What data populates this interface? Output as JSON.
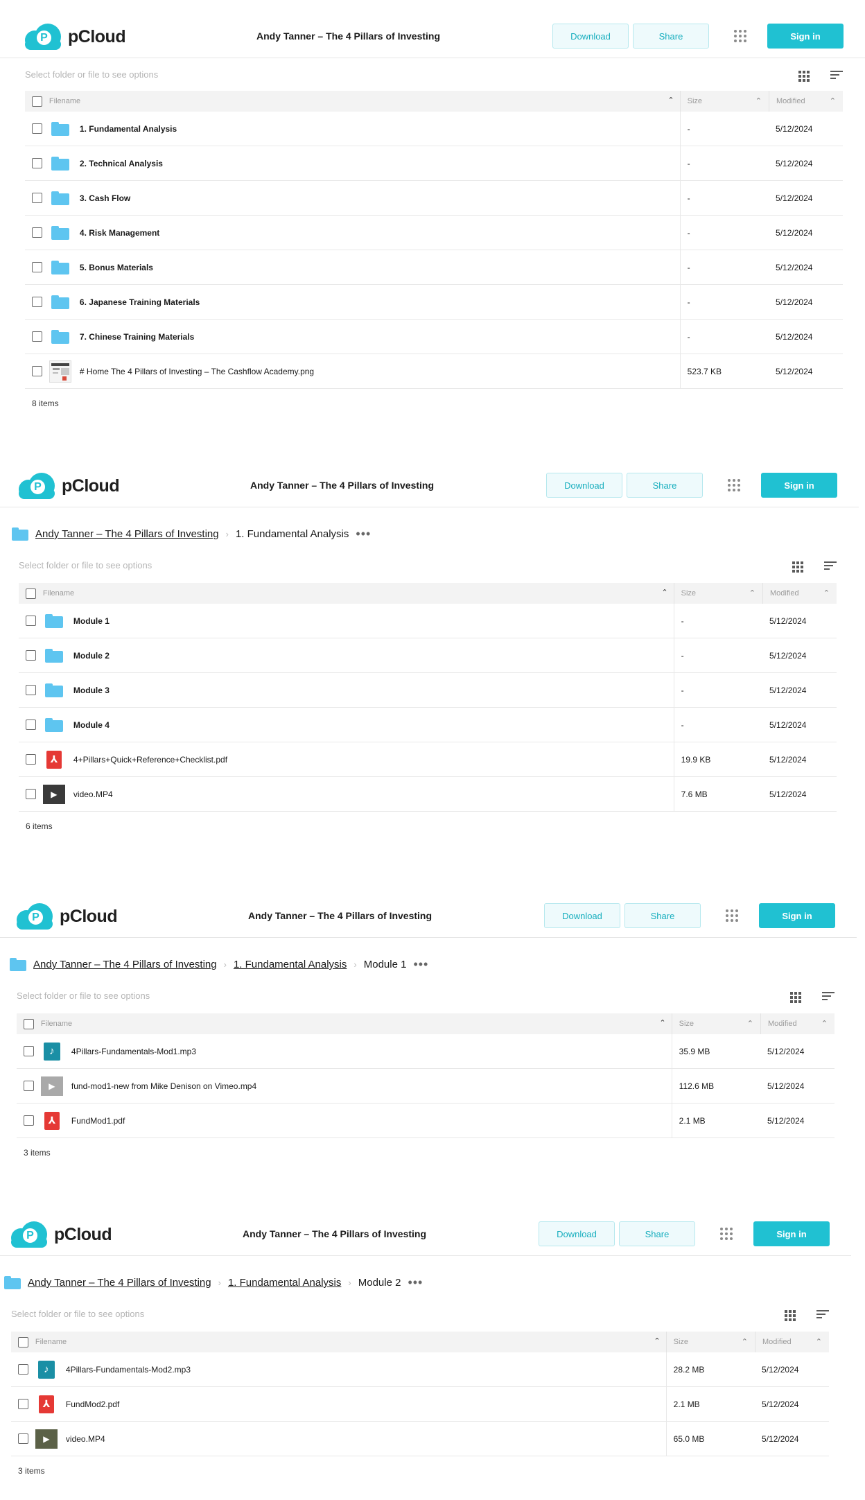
{
  "brand": {
    "name": "pCloud",
    "logo_letter": "P"
  },
  "colors": {
    "accent": "#20c1d2",
    "folder": "#5ec5f0",
    "pdf": "#e53935",
    "audio": "#1a8fa5"
  },
  "header": {
    "title": "Andy Tanner – The 4 Pillars of Investing",
    "download_label": "Download",
    "share_label": "Share",
    "signin_label": "Sign in"
  },
  "toolbar": {
    "hint": "Select folder or file to see options"
  },
  "columns": {
    "name": "Filename",
    "size": "Size",
    "modified": "Modified"
  },
  "panels": [
    {
      "breadcrumb": [],
      "current": "",
      "count": "8 items",
      "rows": [
        {
          "icon": "folder",
          "name": "1. Fundamental Analysis",
          "size": "-",
          "modified": "5/12/2024",
          "bold": true
        },
        {
          "icon": "folder",
          "name": "2. Technical Analysis",
          "size": "-",
          "modified": "5/12/2024",
          "bold": true
        },
        {
          "icon": "folder",
          "name": "3. Cash Flow",
          "size": "-",
          "modified": "5/12/2024",
          "bold": true
        },
        {
          "icon": "folder",
          "name": "4. Risk Management",
          "size": "-",
          "modified": "5/12/2024",
          "bold": true
        },
        {
          "icon": "folder",
          "name": "5. Bonus Materials",
          "size": "-",
          "modified": "5/12/2024",
          "bold": true
        },
        {
          "icon": "folder",
          "name": "6. Japanese Training Materials",
          "size": "-",
          "modified": "5/12/2024",
          "bold": true
        },
        {
          "icon": "folder",
          "name": "7. Chinese Training Materials",
          "size": "-",
          "modified": "5/12/2024",
          "bold": true
        },
        {
          "icon": "image",
          "name": "# Home The 4 Pillars of Investing – The Cashflow Academy.png",
          "size": "523.7 KB",
          "modified": "5/12/2024",
          "bold": false
        }
      ]
    },
    {
      "breadcrumb": [
        "Andy Tanner – The 4 Pillars of Investing"
      ],
      "current": "1. Fundamental Analysis",
      "count": "6 items",
      "rows": [
        {
          "icon": "folder",
          "name": "Module 1",
          "size": "-",
          "modified": "5/12/2024",
          "bold": true
        },
        {
          "icon": "folder",
          "name": "Module 2",
          "size": "-",
          "modified": "5/12/2024",
          "bold": true
        },
        {
          "icon": "folder",
          "name": "Module 3",
          "size": "-",
          "modified": "5/12/2024",
          "bold": true
        },
        {
          "icon": "folder",
          "name": "Module 4",
          "size": "-",
          "modified": "5/12/2024",
          "bold": true
        },
        {
          "icon": "pdf",
          "name": "4+Pillars+Quick+Reference+Checklist.pdf",
          "size": "19.9 KB",
          "modified": "5/12/2024",
          "bold": false
        },
        {
          "icon": "video",
          "name": "video.MP4",
          "size": "7.6 MB",
          "modified": "5/12/2024",
          "bold": false
        }
      ]
    },
    {
      "breadcrumb": [
        "Andy Tanner – The 4 Pillars of Investing",
        "1. Fundamental Analysis"
      ],
      "current": "Module 1",
      "count": "3 items",
      "rows": [
        {
          "icon": "audio",
          "name": "4Pillars-Fundamentals-Mod1.mp3",
          "size": "35.9 MB",
          "modified": "5/12/2024",
          "bold": false
        },
        {
          "icon": "video-gray",
          "name": "fund-mod1-new from Mike Denison on Vimeo.mp4",
          "size": "112.6 MB",
          "modified": "5/12/2024",
          "bold": false
        },
        {
          "icon": "pdf",
          "name": "FundMod1.pdf",
          "size": "2.1 MB",
          "modified": "5/12/2024",
          "bold": false
        }
      ]
    },
    {
      "breadcrumb": [
        "Andy Tanner – The 4 Pillars of Investing",
        "1. Fundamental Analysis"
      ],
      "current": "Module 2",
      "count": "3 items",
      "rows": [
        {
          "icon": "audio",
          "name": "4Pillars-Fundamentals-Mod2.mp3",
          "size": "28.2 MB",
          "modified": "5/12/2024",
          "bold": false
        },
        {
          "icon": "pdf",
          "name": "FundMod2.pdf",
          "size": "2.1 MB",
          "modified": "5/12/2024",
          "bold": false
        },
        {
          "icon": "video-olive",
          "name": "video.MP4",
          "size": "65.0 MB",
          "modified": "5/12/2024",
          "bold": false
        }
      ]
    }
  ]
}
